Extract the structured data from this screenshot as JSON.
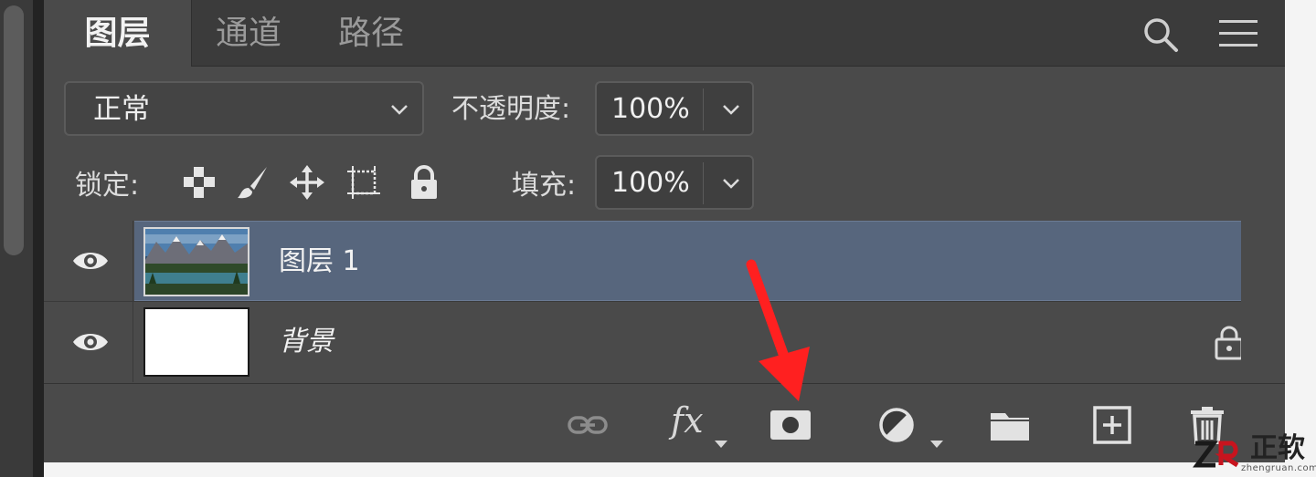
{
  "tabs": [
    "图层",
    "通道",
    "路径"
  ],
  "blend_mode": "正常",
  "opacity": {
    "label": "不透明度:",
    "value": "100%"
  },
  "lock": {
    "label": "锁定:"
  },
  "fill": {
    "label": "填充:",
    "value": "100%"
  },
  "layers": [
    {
      "name": "图层 1",
      "visible": true,
      "selected": true,
      "thumb": "mountain-lake-image"
    },
    {
      "name": "背景",
      "visible": true,
      "selected": false,
      "locked": true,
      "thumb": "white"
    }
  ],
  "bottom_toolbar": {
    "fx_label": "fx",
    "icons": [
      "link-layers-icon",
      "fx-icon",
      "add-mask-icon",
      "adjustment-layer-icon",
      "new-group-icon",
      "new-layer-icon",
      "delete-icon"
    ]
  },
  "watermark": {
    "text": "正软",
    "small": "zhengruan.com"
  },
  "colors": {
    "panel_bg": "#4a4a4a",
    "tabbar_bg": "#3b3b3b",
    "selected_layer": "#57667d",
    "annotation_arrow": "#ff2020"
  }
}
